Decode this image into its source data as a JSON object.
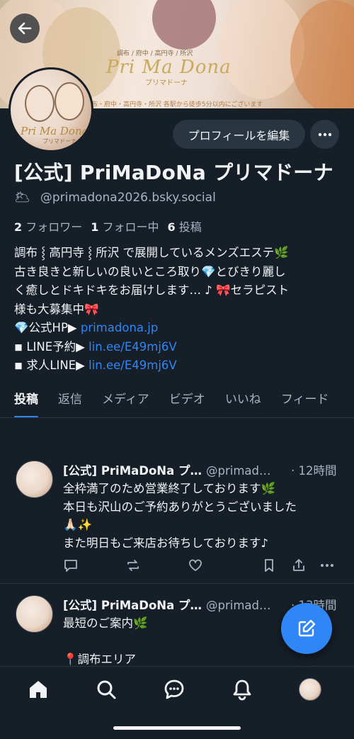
{
  "banner": {
    "title": "Pri Ma Dona",
    "subtitle": "プリマドーナ",
    "top_text": "調布 / 府中 / 高円寺 / 所沢",
    "footer_text": "調布・府中・高円寺・所沢 各駅から徒歩5分以内にございます"
  },
  "avatar_logo": {
    "title": "Pri Ma Dona",
    "subtitle": "プリマドーナ"
  },
  "header": {
    "edit_profile_label": "プロフィールを編集",
    "more_icon": "ellipsis-icon",
    "back_icon": "arrow-left-icon"
  },
  "profile": {
    "display_name": "[公式] PriMaDoNa プリマドーナ",
    "handle_emoji": "🌥",
    "handle": "@primadona2026.bsky.social",
    "followers_count": "2",
    "followers_label": "フォロワー",
    "following_count": "1",
    "following_label": "フォロー中",
    "posts_count": "6",
    "posts_label": "投稿"
  },
  "bio": {
    "line1": "調布 ⸾ 高円寺 ⸾ 所沢 で展開しているメンズエステ🌿",
    "line2": "古き良きと新しいの良いところ取り💎とびきり麗し",
    "line3": "く癒しとドキドキをお届けします… ♪ 🎀セラピスト",
    "line4": "様も大募集中🎀",
    "hp_prefix": "💎公式HP▶ ",
    "hp_link": "primadona.jp",
    "line_prefix": "◾ LINE予約▶ ",
    "line_link": "lin.ee/E49mj6V",
    "job_prefix": "◾ 求人LINE▶ ",
    "job_link": "lin.ee/E49mj6V"
  },
  "tabs": [
    {
      "label": "投稿",
      "active": true
    },
    {
      "label": "返信"
    },
    {
      "label": "メディア"
    },
    {
      "label": "ビデオ"
    },
    {
      "label": "いいね"
    },
    {
      "label": "フィード"
    }
  ],
  "posts": [
    {
      "name": "[公式] PriMaDoNa プ…",
      "handle": "@primad…",
      "time": "· 12時間",
      "lines": [
        "全枠満了のため営業終了しております🌿",
        "本日も沢山のご予約ありがとうございました",
        "🙏🏻✨",
        "また明日もご来店お待ちしております♪"
      ]
    },
    {
      "name": "[公式] PriMaDoNa プ…",
      "handle": "@primad…",
      "time": "· 13時間",
      "lines": [
        "最短のご案内🌿",
        "",
        "📍調布エリア"
      ]
    }
  ],
  "post_actions": {
    "reply_icon": "reply-icon",
    "repost_icon": "repost-icon",
    "like_icon": "heart-icon",
    "bookmark_icon": "bookmark-icon",
    "share_icon": "share-icon",
    "more_icon": "ellipsis-icon"
  },
  "fab": {
    "icon": "compose-icon"
  },
  "bottom_nav": [
    {
      "icon": "home-icon",
      "active": true
    },
    {
      "icon": "search-icon"
    },
    {
      "icon": "chat-icon"
    },
    {
      "icon": "bell-icon"
    },
    {
      "icon": "profile-avatar"
    }
  ],
  "colors": {
    "background": "#161e27",
    "accent": "#2f86f6",
    "text": "#f1f3f5",
    "muted": "#a7b4c2",
    "surface": "#2a3542"
  }
}
